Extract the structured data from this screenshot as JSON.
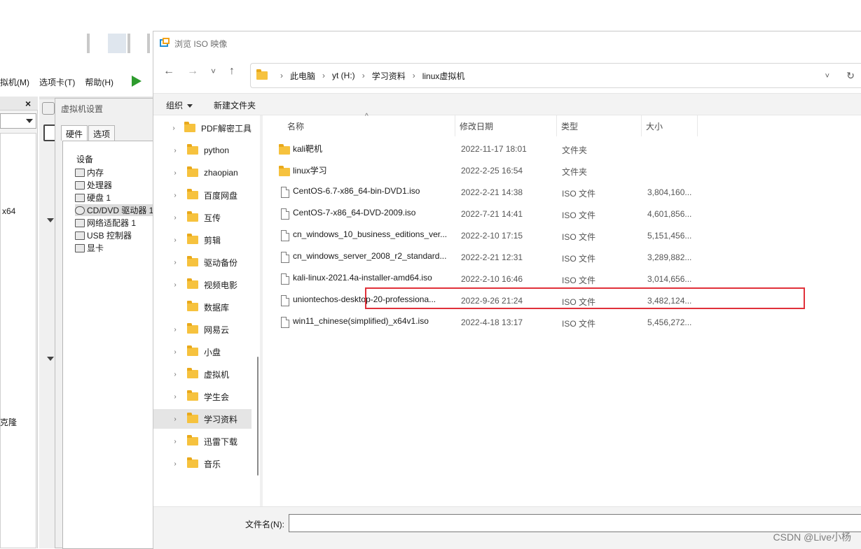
{
  "vmware": {
    "menu": [
      "拟机(M)",
      "选项卡(T)",
      "帮助(H)"
    ],
    "left_close": "×",
    "left_x64": "x64",
    "left_clone": "克隆",
    "settings": {
      "title": "虚拟机设置",
      "tabs": [
        "硬件",
        "选项"
      ],
      "device_header": "设备",
      "devices": [
        "内存",
        "处理器",
        "硬盘 1",
        "CD/DVD 驱动器 1",
        "网络适配器 1",
        "USB 控制器",
        "显卡"
      ]
    }
  },
  "dialog": {
    "title": "浏览 ISO 映像",
    "nav": {
      "back": "←",
      "forward": "→",
      "recent": "˅",
      "up": "↑"
    },
    "breadcrumb": [
      "此电脑",
      "yt (H:)",
      "学习资料",
      "linux虚拟机"
    ],
    "address_dropdown": "˅",
    "refresh": "↻",
    "toolbar": {
      "organize": "组织",
      "new_folder": "新建文件夹"
    },
    "tree": [
      {
        "label": "PDF解密工具",
        "chevron": true
      },
      {
        "label": "python",
        "chevron": true
      },
      {
        "label": "zhaopian",
        "chevron": true
      },
      {
        "label": "百度网盘",
        "chevron": true
      },
      {
        "label": "互传",
        "chevron": true
      },
      {
        "label": "剪辑",
        "chevron": true
      },
      {
        "label": "驱动备份",
        "chevron": true
      },
      {
        "label": "视频电影",
        "chevron": true
      },
      {
        "label": "数据库",
        "chevron": false
      },
      {
        "label": "网易云",
        "chevron": true
      },
      {
        "label": "小盘",
        "chevron": true
      },
      {
        "label": "虚拟机",
        "chevron": true
      },
      {
        "label": "学生会",
        "chevron": true
      },
      {
        "label": "学习资料",
        "chevron": true,
        "selected": true
      },
      {
        "label": "迅雷下载",
        "chevron": true
      },
      {
        "label": "音乐",
        "chevron": true
      }
    ],
    "drive": "yt (H:)",
    "columns": {
      "name": "名称",
      "date": "修改日期",
      "type": "类型",
      "size": "大小"
    },
    "files": [
      {
        "name": "kali靶机",
        "date": "2022-11-17 18:01",
        "type": "文件夹",
        "size": "",
        "kind": "folder"
      },
      {
        "name": "linux学习",
        "date": "2022-2-25 16:54",
        "type": "文件夹",
        "size": "",
        "kind": "folder"
      },
      {
        "name": "CentOS-6.7-x86_64-bin-DVD1.iso",
        "date": "2022-2-21 14:38",
        "type": "ISO 文件",
        "size": "3,804,160...",
        "kind": "file"
      },
      {
        "name": "CentOS-7-x86_64-DVD-2009.iso",
        "date": "2022-7-21 14:41",
        "type": "ISO 文件",
        "size": "4,601,856...",
        "kind": "file",
        "highlighted": true
      },
      {
        "name": "cn_windows_10_business_editions_ver...",
        "date": "2022-2-10 17:15",
        "type": "ISO 文件",
        "size": "5,151,456...",
        "kind": "file"
      },
      {
        "name": "cn_windows_server_2008_r2_standard...",
        "date": "2022-2-21 12:31",
        "type": "ISO 文件",
        "size": "3,289,882...",
        "kind": "file"
      },
      {
        "name": "kali-linux-2021.4a-installer-amd64.iso",
        "date": "2022-2-10 16:46",
        "type": "ISO 文件",
        "size": "3,014,656...",
        "kind": "file"
      },
      {
        "name": "uniontechos-desktop-20-professiona...",
        "date": "2022-9-26 21:24",
        "type": "ISO 文件",
        "size": "3,482,124...",
        "kind": "file"
      },
      {
        "name": "win11_chinese(simplified)_x64v1.iso",
        "date": "2022-4-18 13:17",
        "type": "ISO 文件",
        "size": "5,456,272...",
        "kind": "file"
      }
    ],
    "filename_label": "文件名(N):",
    "filename_value": ""
  },
  "watermark": "CSDN @Live小杨",
  "colors": {
    "highlight": "#e0313a",
    "folder": "#f6c23e",
    "play": "#2e9b2e"
  }
}
